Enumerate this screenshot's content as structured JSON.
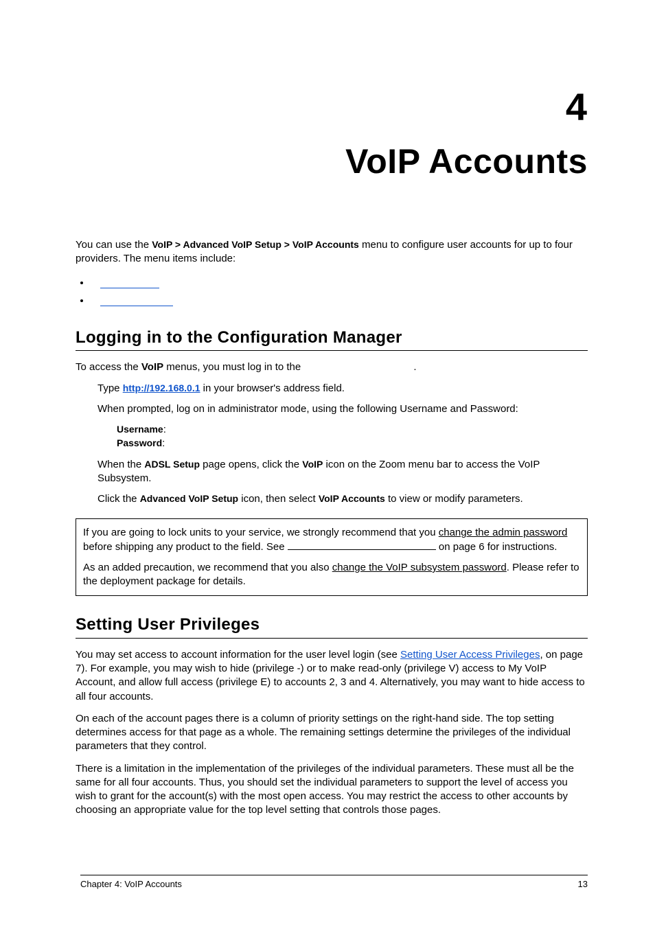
{
  "chapter": {
    "number": "4",
    "title": "VoIP Accounts"
  },
  "intro": {
    "pre": "You can use the ",
    "menu": "VoIP > Advanced VoIP Setup > VoIP Accounts",
    "post": " menu to configure user accounts for up to four providers. The menu items include:"
  },
  "section1": {
    "title": "Logging in to the Configuration Manager",
    "p1_pre": "To access the ",
    "p1_bold": "VoIP",
    "p1_post": " menus, you must log in to the ",
    "p1_end": ".",
    "step1_pre": "Type ",
    "step1_url": "http://192.168.0.1",
    "step1_post": " in your browser's address field.",
    "step2": "When prompted, log on in administrator mode, using the following Username and Password:",
    "cred_user_label": "Username",
    "cred_user_colon": ":",
    "cred_pass_label": "Password",
    "cred_pass_colon": ":",
    "step3_a": "When the ",
    "step3_b": "ADSL Setup",
    "step3_c": " page opens, click the ",
    "step3_d": "VoIP",
    "step3_e": " icon on the Zoom menu bar to access the VoIP Subsystem.",
    "step4_a": "Click the ",
    "step4_b": "Advanced VoIP Setup",
    "step4_c": " icon, then select ",
    "step4_d": "VoIP Accounts",
    "step4_e": " to view or modify parameters."
  },
  "notebox": {
    "p1_a": "If you are going to lock units to your service, we strongly recommend that you ",
    "p1_u1": "change the admin password",
    "p1_b": " before shipping any product to the field. See  ",
    "p1_c": " on page 6 for instructions.",
    "p2_a": "As an added precaution, we recommend that you also ",
    "p2_u1": "change the VoIP subsystem password",
    "p2_b": ". Please refer to the deployment package for details."
  },
  "section2": {
    "title": "Setting User Privileges",
    "p1_a": "You may set access to account information for the user level login (see ",
    "p1_link": "Setting User Access Privileges",
    "p1_b": ", on page 7). For example, you may wish to hide (privilege -) or to make read-only (privilege V) access to My VoIP Account, and allow full access (privilege E) to accounts 2, 3 and 4. Alternatively, you may want to hide access to all four accounts.",
    "p2": "On each of the account pages there is a column of priority settings on the right-hand side. The top setting determines access for that page as a whole. The remaining settings determine the privileges of the individual parameters that they control.",
    "p3": "There is a limitation in the implementation of the privileges of the individual parameters. These must all be the same for all four accounts. Thus, you should set the individual parameters to support the level of access you wish to grant for the account(s) with the most open access. You may restrict the access to other accounts by choosing an appropriate value for the top level setting that controls those pages."
  },
  "footer": {
    "left": "Chapter 4:  VoIP Accounts",
    "right": "13"
  }
}
